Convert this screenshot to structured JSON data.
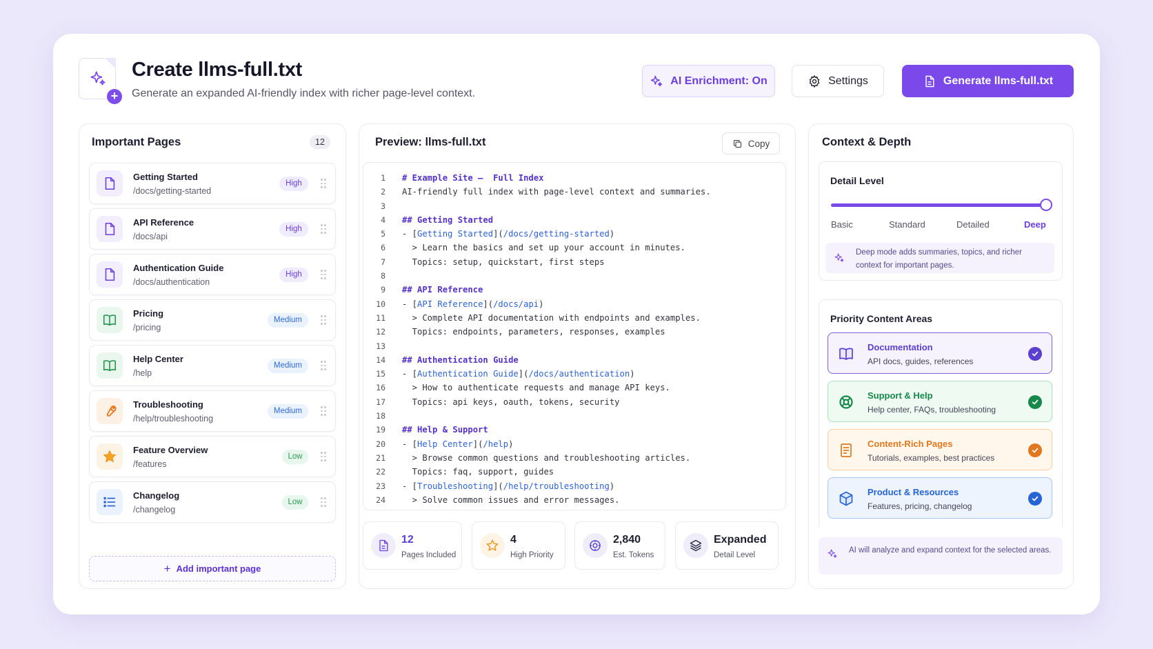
{
  "header": {
    "title": "Create llms-full.txt",
    "subtitle": "Generate an expanded AI-friendly index with richer page-level context.",
    "ai_button": "AI Enrichment: On",
    "settings_button": "Settings",
    "generate_button": "Generate llms-full.txt"
  },
  "left": {
    "title": "Important Pages",
    "count": "12",
    "pages": [
      {
        "name": "Getting Started",
        "path": "/docs/getting-started",
        "priority": "High",
        "icon": "file-icon"
      },
      {
        "name": "API Reference",
        "path": "/docs/api",
        "priority": "High",
        "icon": "file-icon"
      },
      {
        "name": "Authentication Guide",
        "path": "/docs/authentication",
        "priority": "High",
        "icon": "file-icon"
      },
      {
        "name": "Pricing",
        "path": "/pricing",
        "priority": "Medium",
        "icon": "book-icon"
      },
      {
        "name": "Help Center",
        "path": "/help",
        "priority": "Medium",
        "icon": "book-icon"
      },
      {
        "name": "Troubleshooting",
        "path": "/help/troubleshooting",
        "priority": "Medium",
        "icon": "wrench-icon"
      },
      {
        "name": "Feature Overview",
        "path": "/features",
        "priority": "Low",
        "icon": "star-icon"
      },
      {
        "name": "Changelog",
        "path": "/changelog",
        "priority": "Low",
        "icon": "list-icon"
      }
    ],
    "add_label": "Add important page"
  },
  "middle": {
    "title": "Preview: llms-full.txt",
    "copy_label": "Copy",
    "lines": [
      [
        {
          "t": "# Example Site –  Full Index",
          "c": "h"
        }
      ],
      [
        {
          "t": "AI-friendly full index with page-level context and summaries.",
          "c": "m"
        }
      ],
      [],
      [
        {
          "t": "## Getting Started",
          "c": "h"
        }
      ],
      [
        {
          "t": "- [",
          "c": "m"
        },
        {
          "t": "Getting Started",
          "c": "l"
        },
        {
          "t": "](",
          "c": "m"
        },
        {
          "t": "/docs/getting-started",
          "c": "l"
        },
        {
          "t": ")",
          "c": "m"
        }
      ],
      [
        {
          "t": "  > Learn the basics and set up your account in minutes.",
          "c": "m"
        }
      ],
      [
        {
          "t": "  Topics: setup, quickstart, first steps",
          "c": "m"
        }
      ],
      [],
      [
        {
          "t": "## API Reference",
          "c": "h"
        }
      ],
      [
        {
          "t": "- [",
          "c": "m"
        },
        {
          "t": "API Reference",
          "c": "l"
        },
        {
          "t": "](",
          "c": "m"
        },
        {
          "t": "/docs/api",
          "c": "l"
        },
        {
          "t": ")",
          "c": "m"
        }
      ],
      [
        {
          "t": "  > Complete API documentation with endpoints and examples.",
          "c": "m"
        }
      ],
      [
        {
          "t": "  Topics: endpoints, parameters, responses, examples",
          "c": "m"
        }
      ],
      [],
      [
        {
          "t": "## Authentication Guide",
          "c": "h"
        }
      ],
      [
        {
          "t": "- [",
          "c": "m"
        },
        {
          "t": "Authentication Guide",
          "c": "l"
        },
        {
          "t": "](",
          "c": "m"
        },
        {
          "t": "/docs/authentication",
          "c": "l"
        },
        {
          "t": ")",
          "c": "m"
        }
      ],
      [
        {
          "t": "  > How to authenticate requests and manage API keys.",
          "c": "m"
        }
      ],
      [
        {
          "t": "  Topics: api keys, oauth, tokens, security",
          "c": "m"
        }
      ],
      [],
      [
        {
          "t": "## Help & Support",
          "c": "h"
        }
      ],
      [
        {
          "t": "- [",
          "c": "m"
        },
        {
          "t": "Help Center",
          "c": "l"
        },
        {
          "t": "](",
          "c": "m"
        },
        {
          "t": "/help",
          "c": "l"
        },
        {
          "t": ")",
          "c": "m"
        }
      ],
      [
        {
          "t": "  > Browse common questions and troubleshooting articles.",
          "c": "m"
        }
      ],
      [
        {
          "t": "  Topics: faq, support, guides",
          "c": "m"
        }
      ],
      [
        {
          "t": "- [",
          "c": "m"
        },
        {
          "t": "Troubleshooting",
          "c": "l"
        },
        {
          "t": "](",
          "c": "m"
        },
        {
          "t": "/help/troubleshooting",
          "c": "l"
        },
        {
          "t": ")",
          "c": "m"
        }
      ],
      [
        {
          "t": "  > Solve common issues and error messages.",
          "c": "m"
        }
      ]
    ],
    "stats": [
      {
        "value": "12",
        "label": "Pages Included",
        "icon": "document-icon"
      },
      {
        "value": "4",
        "label": "High Priority",
        "icon": "star-outline-icon"
      },
      {
        "value": "2,840",
        "label": "Est. Tokens",
        "icon": "token-icon"
      },
      {
        "value": "Expanded",
        "label": "Detail Level",
        "icon": "layers-icon"
      }
    ]
  },
  "right": {
    "title": "Context & Depth",
    "detail": {
      "title": "Detail Level",
      "levels": [
        "Basic",
        "Standard",
        "Detailed",
        "Deep"
      ],
      "selected": "Deep",
      "value_fraction": 1.0,
      "note": "Deep mode adds summaries, topics, and richer context for important pages."
    },
    "areas_title": "Priority Content Areas",
    "areas": [
      {
        "name": "Documentation",
        "desc": "API docs, guides, references",
        "icon": "book-open-icon",
        "color": "#5b3fd1",
        "bg": "#f6f3ff",
        "border": "#7e5fe6"
      },
      {
        "name": "Support & Help",
        "desc": "Help center, FAQs, troubleshooting",
        "icon": "lifebuoy-icon",
        "color": "#16894a",
        "bg": "#eefaf2",
        "border": "#a9dfbd"
      },
      {
        "name": "Content-Rich Pages",
        "desc": "Tutorials, examples, best practices",
        "icon": "article-icon",
        "color": "#e2781e",
        "bg": "#fff6ec",
        "border": "#f5cf9c"
      },
      {
        "name": "Product & Resources",
        "desc": "Features, pricing, changelog",
        "icon": "cube-icon",
        "color": "#2563d6",
        "bg": "#eef4fe",
        "border": "#a9c6f2"
      }
    ],
    "footer_note": "AI will analyze and expand context for the selected areas."
  },
  "colors": {
    "accent": "#7b48ea",
    "high": "#6b3ee0",
    "medium": "#2f6ad9",
    "low": "#2c9a52"
  }
}
